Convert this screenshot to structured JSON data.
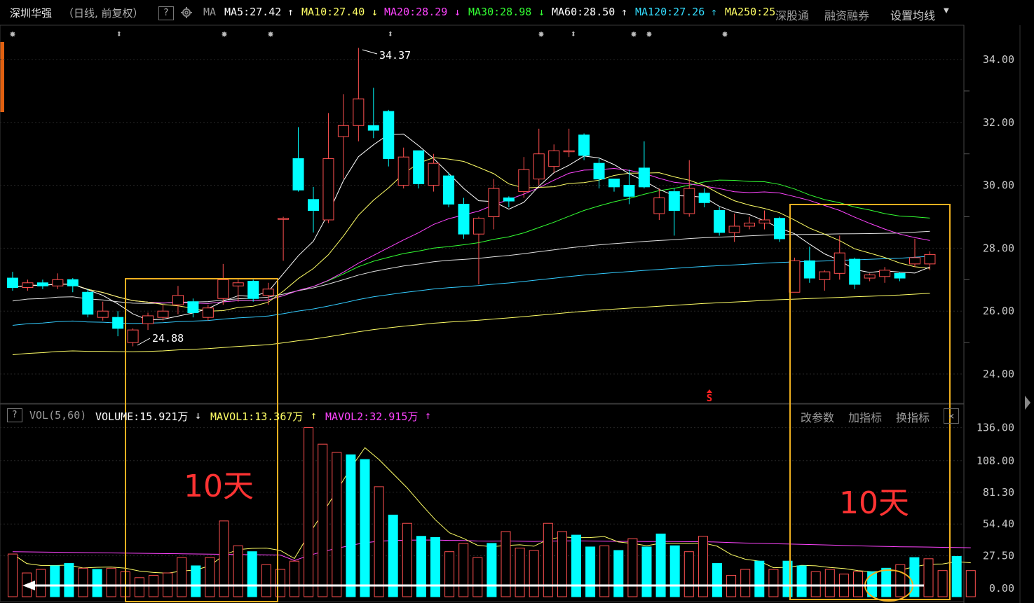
{
  "header": {
    "stock_name": "深圳华强",
    "period": "（日线, 前复权）",
    "help": "?",
    "ma_label": "MA",
    "ma": [
      {
        "label": "MA5:27.42",
        "arrow": "↑",
        "color": "#ffffff"
      },
      {
        "label": "MA10:27.40",
        "arrow": "↓",
        "color": "#ffff66"
      },
      {
        "label": "MA20:28.29",
        "arrow": "↓",
        "color": "#ff44ff"
      },
      {
        "label": "MA30:28.98",
        "arrow": "↓",
        "color": "#33ff33"
      },
      {
        "label": "MA60:28.50",
        "arrow": "↑",
        "color": "#ffffff"
      },
      {
        "label": "MA120:27.26",
        "arrow": "↑",
        "color": "#33ddff"
      },
      {
        "label": "MA250:25",
        "arrow": "",
        "color": "#ffff66"
      }
    ],
    "buttons": [
      "深股通",
      "融资融券",
      "设置均线"
    ]
  },
  "volume_header": {
    "help": "?",
    "vol_label": "VOL(5,60)",
    "volume": "VOLUME:15.921万",
    "volume_arrow": "↓",
    "mavol1": "MAVOL1:13.367万",
    "mavol1_arrow": "↑",
    "mavol2": "MAVOL2:32.915万",
    "mavol2_arrow": "↑",
    "buttons": [
      "改参数",
      "加指标",
      "换指标"
    ],
    "close": "×"
  },
  "annotations": {
    "left_days": "10天",
    "right_days": "10天",
    "s_marker": "S"
  },
  "colors": {
    "up": "#ff5050",
    "down": "#00ffff",
    "ma5": "#ffffff",
    "ma10": "#ffff66",
    "ma20": "#ff44ff",
    "ma30": "#33ff33",
    "ma60": "#e0e0e0",
    "ma120": "#33ccff",
    "ma250": "#ffff66",
    "box": "#f0b020",
    "axis_text": "#c8c8c8"
  },
  "chart_data": [
    {
      "type": "candlestick",
      "y_ticks": [
        "34.00",
        "32.00",
        "30.00",
        "28.00",
        "26.00",
        "24.00"
      ],
      "ylim": [
        23.0,
        35.6
      ],
      "high_label": "34.37",
      "low_label": "24.88",
      "candles": [
        {
          "o": 27.05,
          "c": 26.75,
          "h": 27.25,
          "l": 26.65
        },
        {
          "o": 26.75,
          "c": 26.9,
          "h": 27.0,
          "l": 26.65
        },
        {
          "o": 26.9,
          "c": 26.8,
          "h": 27.0,
          "l": 26.7
        },
        {
          "o": 26.8,
          "c": 27.0,
          "h": 27.2,
          "l": 26.7
        },
        {
          "o": 27.0,
          "c": 26.8,
          "h": 27.05,
          "l": 26.6
        },
        {
          "o": 26.6,
          "c": 25.9,
          "h": 26.7,
          "l": 25.8
        },
        {
          "o": 25.8,
          "c": 26.0,
          "h": 26.3,
          "l": 25.7
        },
        {
          "o": 25.8,
          "c": 25.45,
          "h": 26.0,
          "l": 25.2
        },
        {
          "o": 25.0,
          "c": 25.4,
          "h": 25.45,
          "l": 24.88
        },
        {
          "o": 25.6,
          "c": 25.85,
          "h": 25.95,
          "l": 25.4
        },
        {
          "o": 25.8,
          "c": 26.0,
          "h": 26.2,
          "l": 25.7
        },
        {
          "o": 26.2,
          "c": 26.5,
          "h": 26.8,
          "l": 25.9
        },
        {
          "o": 26.3,
          "c": 25.95,
          "h": 26.4,
          "l": 25.8
        },
        {
          "o": 25.8,
          "c": 26.1,
          "h": 26.2,
          "l": 25.7
        },
        {
          "o": 26.4,
          "c": 27.0,
          "h": 27.5,
          "l": 26.2
        },
        {
          "o": 26.8,
          "c": 26.9,
          "h": 27.0,
          "l": 26.3
        },
        {
          "o": 26.95,
          "c": 26.4,
          "h": 27.0,
          "l": 26.3
        },
        {
          "o": 26.5,
          "c": 26.7,
          "h": 26.9,
          "l": 26.2
        },
        {
          "o": 28.95,
          "c": 28.95,
          "h": 29.0,
          "l": 27.6
        },
        {
          "o": 30.85,
          "c": 29.85,
          "h": 31.85,
          "l": 29.8
        },
        {
          "o": 29.55,
          "c": 29.2,
          "h": 29.95,
          "l": 28.5
        },
        {
          "o": 28.9,
          "c": 30.85,
          "h": 32.3,
          "l": 28.8
        },
        {
          "o": 31.55,
          "c": 31.9,
          "h": 32.9,
          "l": 30.2
        },
        {
          "o": 31.9,
          "c": 32.75,
          "h": 34.37,
          "l": 31.4
        },
        {
          "o": 31.9,
          "c": 31.75,
          "h": 33.1,
          "l": 31.5
        },
        {
          "o": 32.35,
          "c": 30.85,
          "h": 32.4,
          "l": 30.6
        },
        {
          "o": 30.0,
          "c": 30.9,
          "h": 31.2,
          "l": 29.9
        },
        {
          "o": 31.1,
          "c": 30.05,
          "h": 31.1,
          "l": 29.9
        },
        {
          "o": 30.0,
          "c": 30.7,
          "h": 31.0,
          "l": 29.8
        },
        {
          "o": 30.3,
          "c": 29.4,
          "h": 30.4,
          "l": 29.3
        },
        {
          "o": 29.4,
          "c": 28.45,
          "h": 29.6,
          "l": 28.3
        },
        {
          "o": 28.45,
          "c": 28.95,
          "h": 29.0,
          "l": 26.85
        },
        {
          "o": 29.0,
          "c": 29.9,
          "h": 30.2,
          "l": 28.6
        },
        {
          "o": 29.6,
          "c": 29.5,
          "h": 29.65,
          "l": 29.3
        },
        {
          "o": 29.8,
          "c": 30.5,
          "h": 30.9,
          "l": 29.6
        },
        {
          "o": 30.2,
          "c": 31.0,
          "h": 31.8,
          "l": 30.0
        },
        {
          "o": 30.6,
          "c": 31.1,
          "h": 31.3,
          "l": 30.4
        },
        {
          "o": 31.1,
          "c": 31.1,
          "h": 31.8,
          "l": 30.9
        },
        {
          "o": 31.6,
          "c": 30.95,
          "h": 31.65,
          "l": 30.8
        },
        {
          "o": 30.7,
          "c": 30.2,
          "h": 30.85,
          "l": 29.9
        },
        {
          "o": 30.2,
          "c": 29.95,
          "h": 30.2,
          "l": 29.8
        },
        {
          "o": 30.0,
          "c": 29.65,
          "h": 30.5,
          "l": 29.4
        },
        {
          "o": 30.55,
          "c": 29.95,
          "h": 31.4,
          "l": 29.9
        },
        {
          "o": 29.1,
          "c": 29.6,
          "h": 29.9,
          "l": 28.9
        },
        {
          "o": 29.8,
          "c": 29.2,
          "h": 29.9,
          "l": 28.4
        },
        {
          "o": 29.1,
          "c": 29.9,
          "h": 30.8,
          "l": 29.0
        },
        {
          "o": 29.75,
          "c": 29.45,
          "h": 29.9,
          "l": 29.3
        },
        {
          "o": 29.2,
          "c": 28.5,
          "h": 29.3,
          "l": 28.4
        },
        {
          "o": 28.5,
          "c": 28.7,
          "h": 29.1,
          "l": 28.2
        },
        {
          "o": 28.7,
          "c": 28.8,
          "h": 29.0,
          "l": 28.6
        },
        {
          "o": 28.8,
          "c": 28.9,
          "h": 29.2,
          "l": 28.6
        },
        {
          "o": 28.95,
          "c": 28.3,
          "h": 29.0,
          "l": 28.2
        },
        {
          "o": 26.6,
          "c": 27.6,
          "h": 27.7,
          "l": 26.6
        },
        {
          "o": 27.6,
          "c": 27.05,
          "h": 28.05,
          "l": 26.9
        },
        {
          "o": 27.0,
          "c": 27.25,
          "h": 27.3,
          "l": 26.65
        },
        {
          "o": 27.2,
          "c": 27.85,
          "h": 28.4,
          "l": 27.0
        },
        {
          "o": 27.65,
          "c": 26.85,
          "h": 27.7,
          "l": 26.7
        },
        {
          "o": 27.05,
          "c": 27.15,
          "h": 27.2,
          "l": 26.95
        },
        {
          "o": 27.1,
          "c": 27.3,
          "h": 27.4,
          "l": 26.9
        },
        {
          "o": 27.2,
          "c": 27.05,
          "h": 27.25,
          "l": 26.95
        },
        {
          "o": 27.5,
          "c": 27.7,
          "h": 28.3,
          "l": 27.4
        },
        {
          "o": 27.5,
          "c": 27.8,
          "h": 27.9,
          "l": 27.3
        }
      ]
    },
    {
      "type": "bar",
      "series_name": "VOLUME",
      "y_ticks": [
        "136.00",
        "108.00",
        "81.30",
        "54.40",
        "27.50",
        "0.00"
      ],
      "ylim": [
        0,
        136
      ],
      "values": [
        29,
        13,
        16,
        19,
        21,
        17,
        16,
        17,
        14,
        9,
        11,
        13,
        26,
        19,
        26,
        57,
        36,
        31,
        20,
        16,
        23,
        136,
        122,
        115,
        113,
        109,
        86,
        62,
        55,
        44,
        43,
        31,
        38,
        26,
        38,
        48,
        34,
        32,
        55,
        48,
        45,
        35,
        36,
        32,
        42,
        35,
        46,
        36,
        31,
        44,
        21,
        11,
        16,
        23,
        16,
        23,
        19,
        14,
        16,
        12,
        14,
        14,
        17,
        20,
        26,
        25,
        15,
        27,
        15
      ],
      "up": [
        1,
        1,
        1,
        0,
        0,
        1,
        0,
        1,
        1,
        1,
        1,
        1,
        1,
        0,
        1,
        1,
        1,
        0,
        1,
        1,
        1,
        1,
        1,
        1,
        0,
        0,
        1,
        0,
        1,
        0,
        0,
        1,
        1,
        1,
        0,
        1,
        1,
        1,
        1,
        1,
        0,
        0,
        1,
        0,
        1,
        0,
        0,
        0,
        1,
        1,
        0,
        1,
        1,
        0,
        1,
        0,
        0,
        1,
        1,
        1,
        1,
        0,
        0,
        1,
        0,
        1,
        1,
        0,
        1
      ]
    }
  ]
}
